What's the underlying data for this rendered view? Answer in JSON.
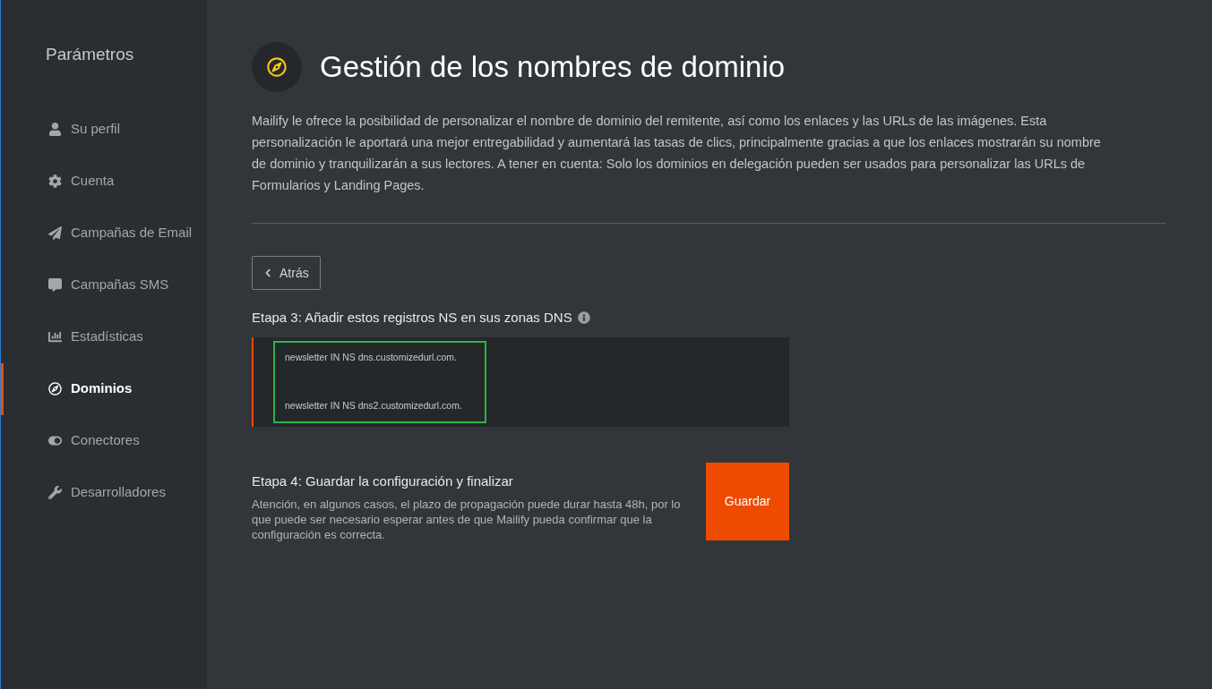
{
  "sidebar": {
    "title": "Parámetros",
    "items": [
      {
        "label": "Su perfil",
        "selected": false
      },
      {
        "label": "Cuenta",
        "selected": false
      },
      {
        "label": "Campañas de Email",
        "selected": false
      },
      {
        "label": "Campañas SMS",
        "selected": false
      },
      {
        "label": "Estadísticas",
        "selected": false
      },
      {
        "label": "Dominios",
        "selected": true
      },
      {
        "label": "Conectores",
        "selected": false
      },
      {
        "label": "Desarrolladores",
        "selected": false
      }
    ]
  },
  "header": {
    "title": "Gestión de los nombres de dominio"
  },
  "description": "Mailify le ofrece la posibilidad de personalizar el nombre de dominio del remitente, así como los enlaces y las URLs de las imágenes. Esta personalización le aportará una mejor entregabilidad y aumentará las tasas de clics, principalmente gracias a que los enlaces mostrarán su nombre de dominio y tranquilizarán a sus lectores. A tener en cuenta: Solo los dominios en delegación pueden ser usados para personalizar las URLs de Formularios y Landing Pages.",
  "back_button": "Atrás",
  "step3": {
    "title": "Etapa 3: Añadir estos registros NS en sus zonas DNS",
    "records": [
      "newsletter IN NS dns.customizedurl.com.",
      "newsletter IN NS dns2.customizedurl.com."
    ]
  },
  "step4": {
    "title": "Etapa 4: Guardar la configuración y finalizar",
    "note": "Atención, en algunos casos, el plazo de propagación puede durar hasta 48h, por lo que puede ser necesario esperar antes de que Mailify pueda confirmar que la configuración es correcta.",
    "button": "Guardar"
  }
}
